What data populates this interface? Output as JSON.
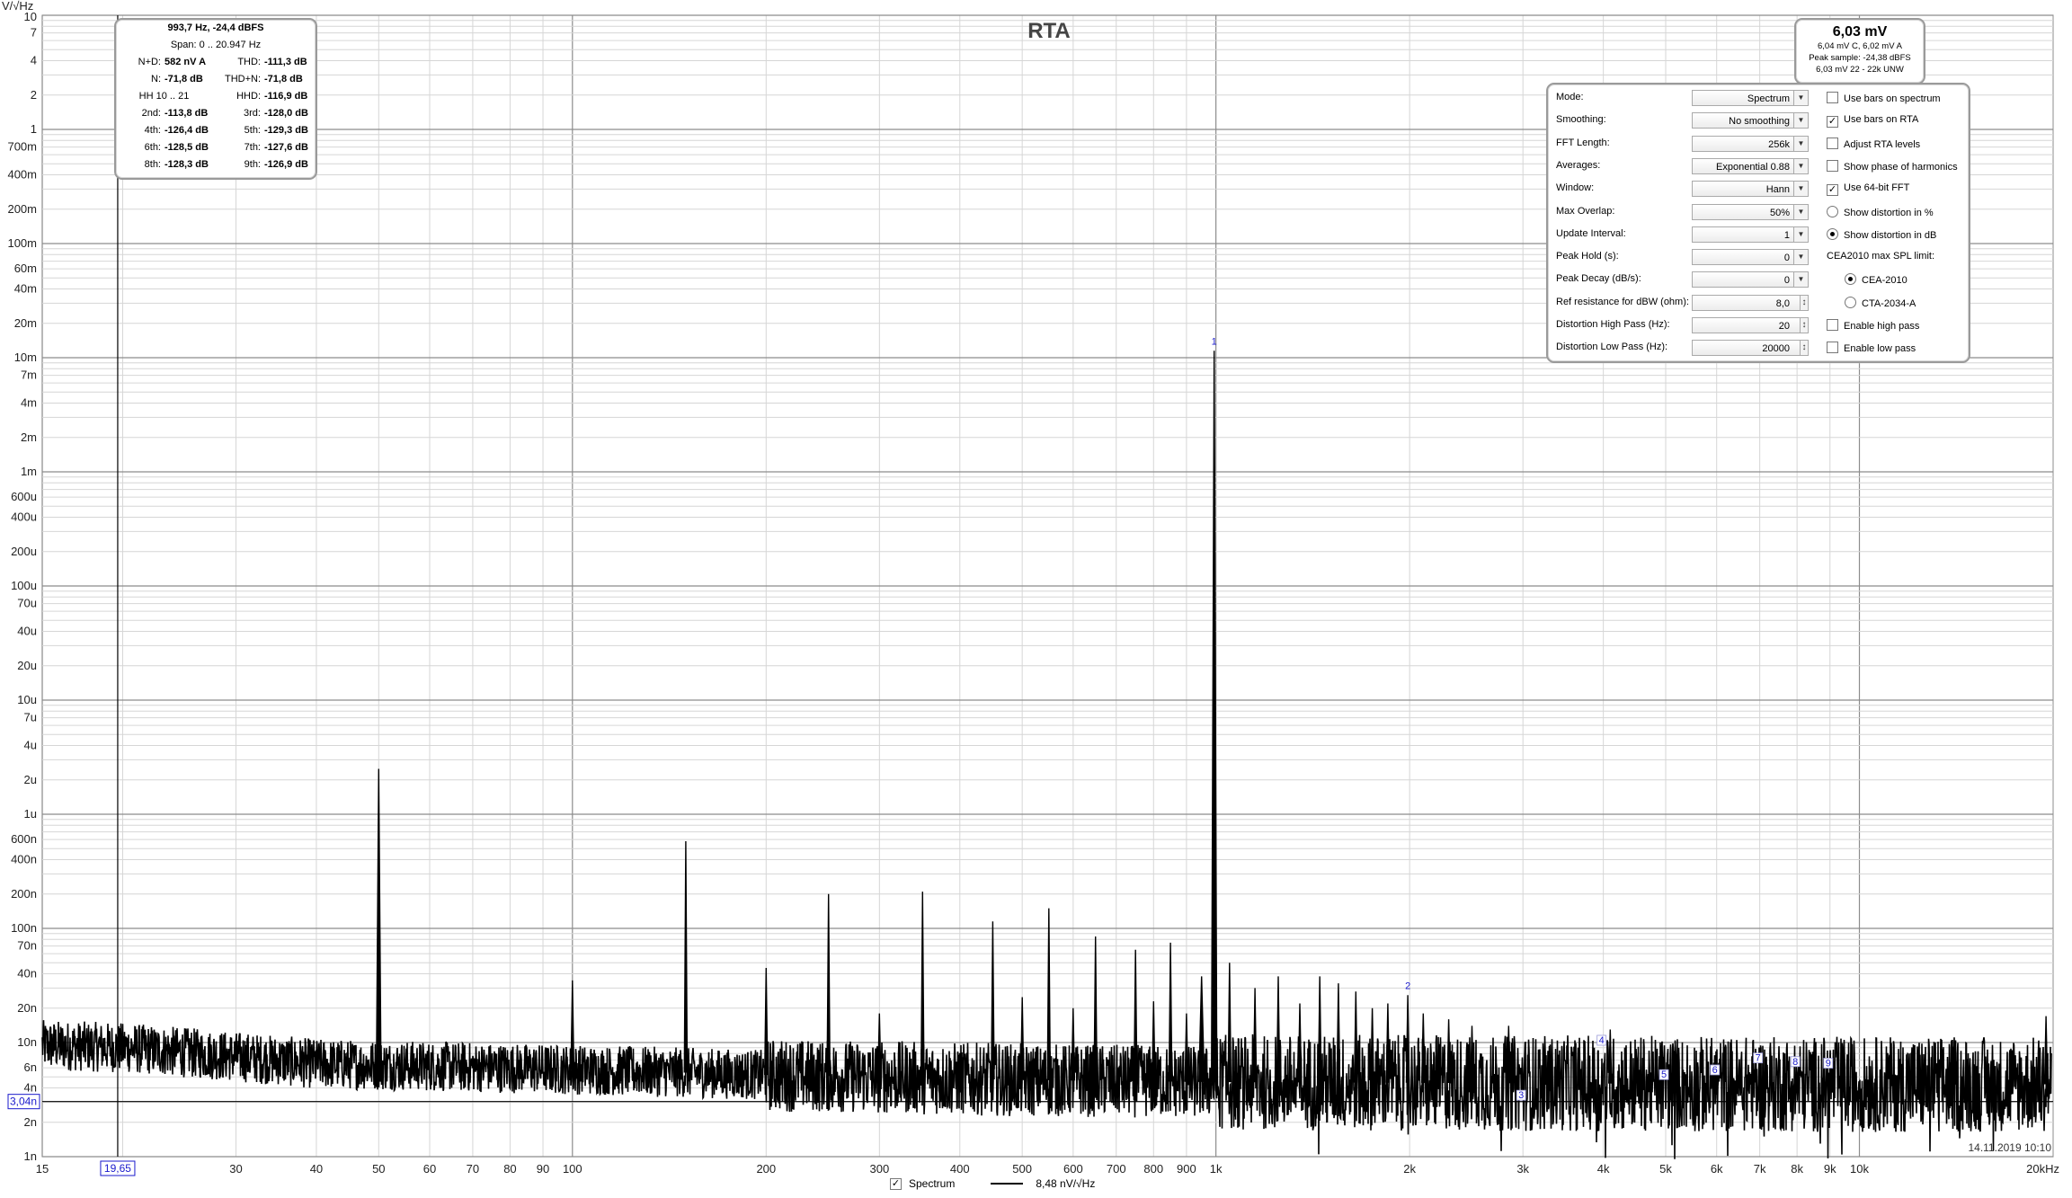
{
  "window": {
    "title": "RTA"
  },
  "date_stamp": "14.11.2019 10:10",
  "cursor": {
    "x_readout": "19,65",
    "y_readout": "3,04n"
  },
  "stats": {
    "header": "993,7 Hz, -24,4 dBFS",
    "span": "Span: 0 .. 20.947 Hz",
    "rows": [
      {
        "k1": "N+D:",
        "v1": "582 nV A",
        "k2": "THD:",
        "v2": "-111,3 dB"
      },
      {
        "k1": "N:",
        "v1": "-71,8 dB",
        "k2": "THD+N:",
        "v2": "-71,8 dB"
      },
      {
        "k1": "HH 10 .. 21",
        "v1": "",
        "k2": "HHD:",
        "v2": "-116,9 dB"
      },
      {
        "k1": "2nd:",
        "v1": "-113,8 dB",
        "k2": "3rd:",
        "v2": "-128,0 dB"
      },
      {
        "k1": "4th:",
        "v1": "-126,4 dB",
        "k2": "5th:",
        "v2": "-129,3 dB"
      },
      {
        "k1": "6th:",
        "v1": "-128,5 dB",
        "k2": "7th:",
        "v2": "-127,6 dB"
      },
      {
        "k1": "8th:",
        "v1": "-128,3 dB",
        "k2": "9th:",
        "v2": "-126,9 dB"
      }
    ]
  },
  "level": {
    "main": "6,03 mV",
    "line1": "6,04 mV C, 6,02 mV A",
    "line2": "Peak sample: -24,38 dBFS",
    "line3": "6,03 mV 22 - 22k UNW"
  },
  "settings": {
    "rows": [
      {
        "label": "Mode:",
        "value": "Spectrum",
        "spinner": false,
        "opt": {
          "kind": "check",
          "checked": false,
          "text": "Use bars on spectrum"
        }
      },
      {
        "label": "Smoothing:",
        "value": "No  smoothing",
        "spinner": false,
        "opt": {
          "kind": "check",
          "checked": true,
          "text": "Use bars on RTA"
        }
      },
      {
        "label": "FFT Length:",
        "value": "256k",
        "spinner": false,
        "opt": {
          "kind": "check",
          "checked": false,
          "text": "Adjust RTA levels"
        }
      },
      {
        "label": "Averages:",
        "value": "Exponential 0.88",
        "spinner": false,
        "opt": {
          "kind": "check",
          "checked": false,
          "text": "Show phase of harmonics"
        }
      },
      {
        "label": "Window:",
        "value": "Hann",
        "spinner": false,
        "opt": {
          "kind": "check",
          "checked": true,
          "text": "Use 64-bit FFT"
        }
      },
      {
        "label": "Max Overlap:",
        "value": "50%",
        "spinner": false,
        "opt": {
          "kind": "radio",
          "checked": false,
          "text": "Show distortion in %"
        }
      },
      {
        "label": "Update Interval:",
        "value": "1",
        "spinner": false,
        "opt": {
          "kind": "radio",
          "checked": true,
          "text": "Show distortion in dB"
        }
      },
      {
        "label": "Peak Hold (s):",
        "value": "0",
        "spinner": false,
        "opt": {
          "kind": "label",
          "checked": false,
          "text": "CEA2010 max SPL limit:"
        }
      },
      {
        "label": "Peak Decay (dB/s):",
        "value": "0",
        "spinner": false,
        "opt": {
          "kind": "radio-indent",
          "checked": true,
          "text": "CEA-2010"
        }
      },
      {
        "label": "Ref resistance for dBW (ohm):",
        "value": "8,0",
        "spinner": true,
        "opt": {
          "kind": "radio-indent",
          "checked": false,
          "text": "CTA-2034-A"
        }
      },
      {
        "label": "Distortion High Pass (Hz):",
        "value": "20",
        "spinner": true,
        "opt": {
          "kind": "check",
          "checked": false,
          "text": "Enable high pass"
        }
      },
      {
        "label": "Distortion Low Pass (Hz):",
        "value": "20000",
        "spinner": true,
        "opt": {
          "kind": "check",
          "checked": false,
          "text": "Enable low pass"
        }
      }
    ]
  },
  "legend": {
    "series_label": "Spectrum",
    "readout": "8,48 nV/√Hz"
  },
  "chart_data": {
    "type": "line",
    "title": "RTA",
    "ylabel": "V/√Hz",
    "xscale": "log",
    "yscale": "log",
    "xlim": [
      15,
      20000
    ],
    "ylim": [
      1e-09,
      10
    ],
    "grid": true,
    "x_ticks": [
      {
        "v": 15,
        "t": "15"
      },
      {
        "v": 20,
        "t": "20"
      },
      {
        "v": 30,
        "t": "30"
      },
      {
        "v": 40,
        "t": "40"
      },
      {
        "v": 50,
        "t": "50"
      },
      {
        "v": 60,
        "t": "60"
      },
      {
        "v": 70,
        "t": "70"
      },
      {
        "v": 80,
        "t": "80"
      },
      {
        "v": 90,
        "t": "90"
      },
      {
        "v": 100,
        "t": "100"
      },
      {
        "v": 200,
        "t": "200"
      },
      {
        "v": 300,
        "t": "300"
      },
      {
        "v": 400,
        "t": "400"
      },
      {
        "v": 500,
        "t": "500"
      },
      {
        "v": 600,
        "t": "600"
      },
      {
        "v": 700,
        "t": "700"
      },
      {
        "v": 800,
        "t": "800"
      },
      {
        "v": 900,
        "t": "900"
      },
      {
        "v": 1000,
        "t": "1k"
      },
      {
        "v": 2000,
        "t": "2k"
      },
      {
        "v": 3000,
        "t": "3k"
      },
      {
        "v": 4000,
        "t": "4k"
      },
      {
        "v": 5000,
        "t": "5k"
      },
      {
        "v": 6000,
        "t": "6k"
      },
      {
        "v": 7000,
        "t": "7k"
      },
      {
        "v": 8000,
        "t": "8k"
      },
      {
        "v": 9000,
        "t": "9k"
      },
      {
        "v": 10000,
        "t": "10k"
      },
      {
        "v": 20000,
        "t": "20kHz"
      }
    ],
    "y_ticks": [
      {
        "v": 7,
        "t": "7"
      },
      {
        "v": 4,
        "t": "4"
      },
      {
        "v": 2,
        "t": "2"
      },
      {
        "v": 1,
        "t": "1"
      },
      {
        "v": 0.7,
        "t": "700m"
      },
      {
        "v": 0.4,
        "t": "400m"
      },
      {
        "v": 0.2,
        "t": "200m"
      },
      {
        "v": 0.1,
        "t": "100m"
      },
      {
        "v": 0.06,
        "t": "60m"
      },
      {
        "v": 0.04,
        "t": "40m"
      },
      {
        "v": 0.02,
        "t": "20m"
      },
      {
        "v": 0.01,
        "t": "10m"
      },
      {
        "v": 0.007,
        "t": "7m"
      },
      {
        "v": 0.004,
        "t": "4m"
      },
      {
        "v": 0.002,
        "t": "2m"
      },
      {
        "v": 0.001,
        "t": "1m"
      },
      {
        "v": 0.0006,
        "t": "600u"
      },
      {
        "v": 0.0004,
        "t": "400u"
      },
      {
        "v": 0.0002,
        "t": "200u"
      },
      {
        "v": 0.0001,
        "t": "100u"
      },
      {
        "v": 7e-05,
        "t": "70u"
      },
      {
        "v": 4e-05,
        "t": "40u"
      },
      {
        "v": 2e-05,
        "t": "20u"
      },
      {
        "v": 1e-05,
        "t": "10u"
      },
      {
        "v": 7e-06,
        "t": "7u"
      },
      {
        "v": 4e-06,
        "t": "4u"
      },
      {
        "v": 2e-06,
        "t": "2u"
      },
      {
        "v": 1e-06,
        "t": "1u"
      },
      {
        "v": 6e-07,
        "t": "600n"
      },
      {
        "v": 4e-07,
        "t": "400n"
      },
      {
        "v": 2e-07,
        "t": "200n"
      },
      {
        "v": 1e-07,
        "t": "100n"
      },
      {
        "v": 7e-08,
        "t": "70n"
      },
      {
        "v": 4e-08,
        "t": "40n"
      },
      {
        "v": 2e-08,
        "t": "20n"
      },
      {
        "v": 1e-08,
        "t": "10n"
      },
      {
        "v": 6e-09,
        "t": "6n"
      },
      {
        "v": 4e-09,
        "t": "4n"
      },
      {
        "v": 2e-09,
        "t": "2n"
      },
      {
        "v": 1e-09,
        "t": "1n"
      }
    ],
    "y_top_label": "10",
    "noise_floor_nv": [
      {
        "x": 15,
        "y": 9.5
      },
      {
        "x": 20,
        "y": 9.0
      },
      {
        "x": 30,
        "y": 7.5
      },
      {
        "x": 40,
        "y": 6.5
      },
      {
        "x": 60,
        "y": 6.2
      },
      {
        "x": 100,
        "y": 5.8
      },
      {
        "x": 200,
        "y": 5.2
      },
      {
        "x": 500,
        "y": 4.7
      },
      {
        "x": 1000,
        "y": 4.5
      },
      {
        "x": 3000,
        "y": 4.4
      },
      {
        "x": 10000,
        "y": 4.3
      },
      {
        "x": 20000,
        "y": 4.3
      }
    ],
    "peaks": [
      {
        "x": 50,
        "y": 2.5e-06
      },
      {
        "x": 100,
        "y": 3.5e-08
      },
      {
        "x": 150,
        "y": 5.8e-07
      },
      {
        "x": 200,
        "y": 4.5e-08
      },
      {
        "x": 250,
        "y": 2e-07
      },
      {
        "x": 300,
        "y": 1.8e-08
      },
      {
        "x": 350,
        "y": 2.1e-07
      },
      {
        "x": 450,
        "y": 1.15e-07
      },
      {
        "x": 500,
        "y": 2.5e-08
      },
      {
        "x": 550,
        "y": 1.5e-07
      },
      {
        "x": 600,
        "y": 2e-08
      },
      {
        "x": 650,
        "y": 8.5e-08
      },
      {
        "x": 750,
        "y": 6.5e-08
      },
      {
        "x": 800,
        "y": 2.3e-08
      },
      {
        "x": 850,
        "y": 7.5e-08
      },
      {
        "x": 900,
        "y": 1.8e-08
      },
      {
        "x": 950,
        "y": 3.8e-08
      },
      {
        "x": 993.7,
        "y": 0.0115
      },
      {
        "x": 1050,
        "y": 5e-08
      },
      {
        "x": 1150,
        "y": 3e-08
      },
      {
        "x": 1250,
        "y": 3.8e-08
      },
      {
        "x": 1350,
        "y": 2.2e-08
      },
      {
        "x": 1450,
        "y": 3.8e-08
      },
      {
        "x": 1550,
        "y": 3.3e-08
      },
      {
        "x": 1650,
        "y": 2.8e-08
      },
      {
        "x": 1750,
        "y": 2e-08
      },
      {
        "x": 1850,
        "y": 2.2e-08
      },
      {
        "x": 1987,
        "y": 2.6e-08
      },
      {
        "x": 2100,
        "y": 1.8e-08
      },
      {
        "x": 2300,
        "y": 1.6e-08
      },
      {
        "x": 2500,
        "y": 1.4e-08
      },
      {
        "x": 2850,
        "y": 1.4e-08
      },
      {
        "x": 4100,
        "y": 1.3e-08
      },
      {
        "x": 19500,
        "y": 1.7e-08
      }
    ],
    "harmonic_markers": [
      {
        "x": 993.7,
        "y": 0.0115,
        "label": "1"
      },
      {
        "x": 1987.4,
        "y": 2.6e-08,
        "label": "2"
      },
      {
        "x": 2981,
        "y": 3.3e-09,
        "label": "3"
      },
      {
        "x": 3975,
        "y": 1e-08,
        "label": "4"
      },
      {
        "x": 4968,
        "y": 5e-09,
        "label": "5"
      },
      {
        "x": 5962,
        "y": 5.5e-09,
        "label": "6"
      },
      {
        "x": 6956,
        "y": 7e-09,
        "label": "7"
      },
      {
        "x": 7950,
        "y": 6.5e-09,
        "label": "8"
      },
      {
        "x": 8943,
        "y": 6.3e-09,
        "label": "9"
      }
    ],
    "cursor_x": 19.65,
    "cursor_y": 3.04e-09
  },
  "colors": {
    "trace": "#000000",
    "grid_major": "#8c8c8c",
    "grid_minor": "#d6d6d6",
    "marker": "#1a1acc"
  }
}
